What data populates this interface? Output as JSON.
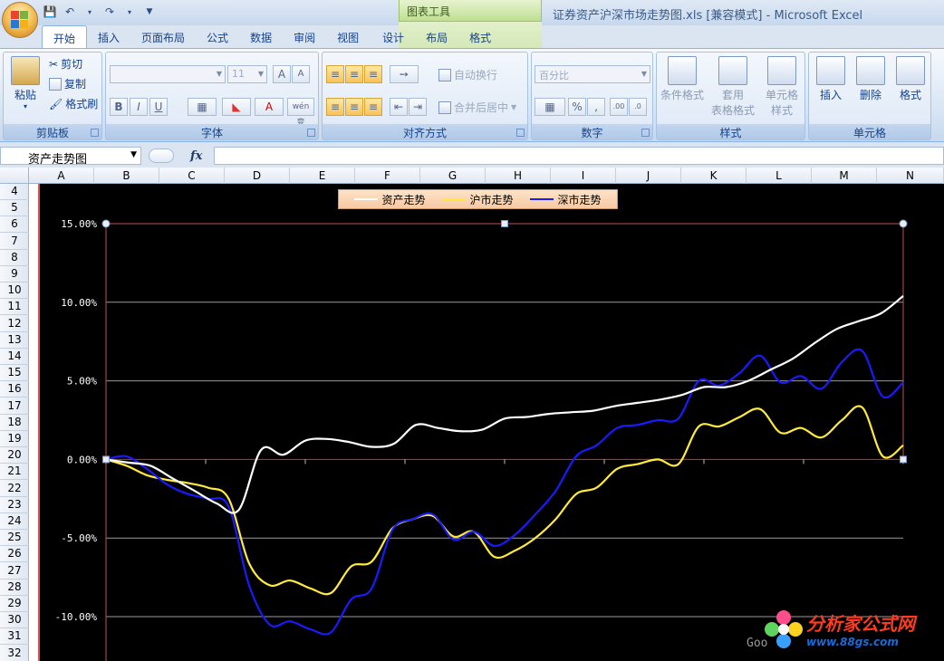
{
  "window": {
    "title": "证券资产沪深市场走势图.xls  [兼容模式] - Microsoft Excel",
    "contextual_group": "图表工具"
  },
  "tabs": [
    {
      "label": "开始",
      "active": true
    },
    {
      "label": "插入"
    },
    {
      "label": "页面布局"
    },
    {
      "label": "公式"
    },
    {
      "label": "数据"
    },
    {
      "label": "审阅"
    },
    {
      "label": "视图"
    },
    {
      "label": "设计",
      "contextual": true
    },
    {
      "label": "布局",
      "contextual": true
    },
    {
      "label": "格式",
      "contextual": true
    }
  ],
  "ribbon": {
    "clipboard": {
      "label": "剪贴板",
      "paste": "粘贴",
      "cut": "剪切",
      "copy": "复制",
      "format_painter": "格式刷"
    },
    "font": {
      "label": "字体",
      "font_size": "11",
      "bold": "B",
      "italic": "I",
      "underline": "U",
      "font_color_glyph": "A",
      "wen": "wén 变"
    },
    "alignment": {
      "label": "对齐方式",
      "wrap_text": "自动换行",
      "merge_center": "合并后居中"
    },
    "number": {
      "label": "数字",
      "format": "百分比",
      "percent": "%",
      "comma": ","
    },
    "styles": {
      "label": "样式",
      "conditional": "条件格式",
      "table_style_1": "套用",
      "table_style_2": "表格格式",
      "cell_style_1": "单元格",
      "cell_style_2": "样式"
    },
    "cells": {
      "label": "单元格",
      "insert": "插入",
      "delete": "删除",
      "format": "格式"
    }
  },
  "formula_bar": {
    "name_box": "资产走势图",
    "fx": "fx",
    "formula": ""
  },
  "columns": [
    "A",
    "B",
    "C",
    "D",
    "E",
    "F",
    "G",
    "H",
    "I",
    "J",
    "K",
    "L",
    "M",
    "N"
  ],
  "rows": [
    "4",
    "5",
    "6",
    "7",
    "8",
    "9",
    "10",
    "11",
    "12",
    "13",
    "14",
    "15",
    "16",
    "17",
    "18",
    "19",
    "20",
    "21",
    "22",
    "23",
    "24",
    "25",
    "26",
    "27",
    "28",
    "29",
    "30",
    "31",
    "32"
  ],
  "chart_data": {
    "type": "line",
    "title": "",
    "xlabel": "",
    "ylabel": "",
    "y_ticks": [
      "15.00%",
      "10.00%",
      "5.00%",
      "0.00%",
      "-5.00%",
      "-10.00%"
    ],
    "ylim": [
      -0.12,
      0.15
    ],
    "legend_position": "top",
    "grid": true,
    "series": [
      {
        "name": "资产走势",
        "color": "#ffffff",
        "values": [
          0.0,
          -0.002,
          -0.004,
          -0.012,
          -0.02,
          -0.028,
          -0.032,
          0.006,
          0.003,
          0.012,
          0.013,
          0.011,
          0.008,
          0.01,
          0.022,
          0.02,
          0.018,
          0.019,
          0.026,
          0.027,
          0.029,
          0.03,
          0.031,
          0.034,
          0.036,
          0.038,
          0.041,
          0.046,
          0.046,
          0.05,
          0.057,
          0.064,
          0.074,
          0.083,
          0.088,
          0.093,
          0.104
        ]
      },
      {
        "name": "沪市走势",
        "color": "#ffeb3b",
        "values": [
          0.0,
          -0.004,
          -0.01,
          -0.013,
          -0.015,
          -0.018,
          -0.025,
          -0.066,
          -0.08,
          -0.077,
          -0.082,
          -0.085,
          -0.068,
          -0.065,
          -0.044,
          -0.038,
          -0.036,
          -0.049,
          -0.046,
          -0.062,
          -0.058,
          -0.05,
          -0.038,
          -0.022,
          -0.018,
          -0.006,
          -0.003,
          0.0,
          -0.003,
          0.021,
          0.021,
          0.027,
          0.032,
          0.017,
          0.02,
          0.014,
          0.025,
          0.033,
          0.002,
          0.009
        ]
      },
      {
        "name": "深市走势",
        "color": "#1a1aff",
        "values": [
          0.0,
          0.002,
          -0.006,
          -0.016,
          -0.022,
          -0.025,
          -0.03,
          -0.08,
          -0.105,
          -0.103,
          -0.108,
          -0.11,
          -0.089,
          -0.082,
          -0.045,
          -0.038,
          -0.035,
          -0.051,
          -0.046,
          -0.055,
          -0.048,
          -0.035,
          -0.02,
          0.002,
          0.009,
          0.02,
          0.022,
          0.025,
          0.026,
          0.05,
          0.047,
          0.055,
          0.066,
          0.049,
          0.053,
          0.045,
          0.062,
          0.069,
          0.04,
          0.049
        ]
      }
    ]
  },
  "watermark": {
    "brand": "分析家公式网",
    "url": "www.88gs.com",
    "left_text": "Goo"
  }
}
